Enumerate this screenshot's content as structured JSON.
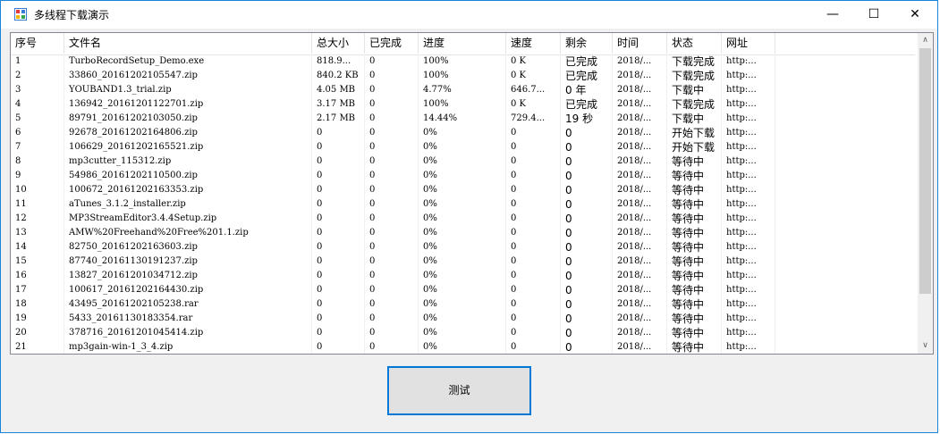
{
  "window": {
    "title": "多线程下载演示",
    "min": "—",
    "max": "☐",
    "close": "✕"
  },
  "columns": [
    "序号",
    "文件名",
    "总大小",
    "已完成",
    "进度",
    "速度",
    "剩余",
    "时间",
    "状态",
    "网址"
  ],
  "rows": [
    [
      "1",
      "TurboRecordSetup_Demo.exe",
      "818.9...",
      "0",
      "100%",
      "0 K",
      "已完成",
      "2018/...",
      "下载完成",
      "http:..."
    ],
    [
      "2",
      "33860_20161202105547.zip",
      "840.2 KB",
      "0",
      "100%",
      "0 K",
      "已完成",
      "2018/...",
      "下载完成",
      "http:..."
    ],
    [
      "3",
      "YOUBAND1.3_trial.zip",
      "4.05 MB",
      "0",
      "4.77%",
      "646.7...",
      "0 年",
      "2018/...",
      "下载中",
      "http:..."
    ],
    [
      "4",
      "136942_20161201122701.zip",
      "3.17 MB",
      "0",
      "100%",
      "0 K",
      "已完成",
      "2018/...",
      "下载完成",
      "http:..."
    ],
    [
      "5",
      "89791_20161202103050.zip",
      "2.17 MB",
      "0",
      "14.44%",
      "729.4...",
      "19 秒",
      "2018/...",
      "下载中",
      "http:..."
    ],
    [
      "6",
      "92678_20161202164806.zip",
      "0",
      "0",
      "0%",
      "0",
      "0",
      "2018/...",
      "开始下载",
      "http:..."
    ],
    [
      "7",
      "106629_20161202165521.zip",
      "0",
      "0",
      "0%",
      "0",
      "0",
      "2018/...",
      "开始下载",
      "http:..."
    ],
    [
      "8",
      "mp3cutter_115312.zip",
      "0",
      "0",
      "0%",
      "0",
      "0",
      "2018/...",
      "等待中",
      "http:..."
    ],
    [
      "9",
      "54986_20161202110500.zip",
      "0",
      "0",
      "0%",
      "0",
      "0",
      "2018/...",
      "等待中",
      "http:..."
    ],
    [
      "10",
      "100672_20161202163353.zip",
      "0",
      "0",
      "0%",
      "0",
      "0",
      "2018/...",
      "等待中",
      "http:..."
    ],
    [
      "11",
      "aTunes_3.1.2_installer.zip",
      "0",
      "0",
      "0%",
      "0",
      "0",
      "2018/...",
      "等待中",
      "http:..."
    ],
    [
      "12",
      "MP3StreamEditor3.4.4Setup.zip",
      "0",
      "0",
      "0%",
      "0",
      "0",
      "2018/...",
      "等待中",
      "http:..."
    ],
    [
      "13",
      "AMW%20Freehand%20Free%201.1.zip",
      "0",
      "0",
      "0%",
      "0",
      "0",
      "2018/...",
      "等待中",
      "http:..."
    ],
    [
      "14",
      "82750_20161202163603.zip",
      "0",
      "0",
      "0%",
      "0",
      "0",
      "2018/...",
      "等待中",
      "http:..."
    ],
    [
      "15",
      "87740_20161130191237.zip",
      "0",
      "0",
      "0%",
      "0",
      "0",
      "2018/...",
      "等待中",
      "http:..."
    ],
    [
      "16",
      "13827_20161201034712.zip",
      "0",
      "0",
      "0%",
      "0",
      "0",
      "2018/...",
      "等待中",
      "http:..."
    ],
    [
      "17",
      "100617_20161202164430.zip",
      "0",
      "0",
      "0%",
      "0",
      "0",
      "2018/...",
      "等待中",
      "http:..."
    ],
    [
      "18",
      "43495_20161202105238.rar",
      "0",
      "0",
      "0%",
      "0",
      "0",
      "2018/...",
      "等待中",
      "http:..."
    ],
    [
      "19",
      "5433_20161130183354.rar",
      "0",
      "0",
      "0%",
      "0",
      "0",
      "2018/...",
      "等待中",
      "http:..."
    ],
    [
      "20",
      "378716_20161201045414.zip",
      "0",
      "0",
      "0%",
      "0",
      "0",
      "2018/...",
      "等待中",
      "http:..."
    ],
    [
      "21",
      "mp3gain-win-1_3_4.zip",
      "0",
      "0",
      "0%",
      "0",
      "0",
      "2018/...",
      "等待中",
      "http:..."
    ]
  ],
  "button": {
    "label": "测试"
  },
  "scrollbar": {
    "up": "∧",
    "down": "∨"
  }
}
